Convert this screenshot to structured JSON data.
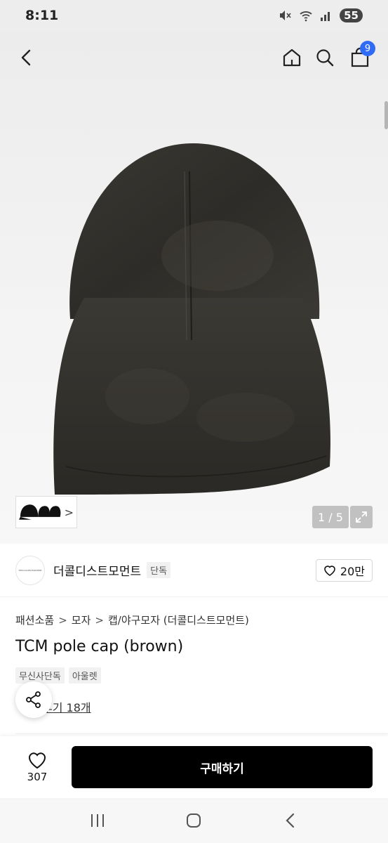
{
  "status_bar": {
    "time": "8:11",
    "battery": "55",
    "icons": [
      "mute-icon",
      "wifi-icon",
      "signal-icon"
    ]
  },
  "header": {
    "back_icon": "chevron-left-icon",
    "home_icon": "home-icon",
    "search_icon": "search-icon",
    "cart_icon": "shopping-bag-icon",
    "cart_count": "9"
  },
  "gallery": {
    "page_counter": "1 / 5",
    "thumb_arrow": ">",
    "expand_icon": "expand-icon"
  },
  "brand": {
    "logo_text": "THECOLDESTMOMENT",
    "name": "더콜디스트모먼트",
    "exclusive_tag": "단독",
    "likes": "20만"
  },
  "product": {
    "breadcrumb": [
      "패션소품",
      "모자",
      "캡/야구모자 (더콜디스트모먼트)"
    ],
    "breadcrumb_sep": ">",
    "title": "TCM pole cap (brown)",
    "tags": [
      "무신사단독",
      "아울렛"
    ],
    "reviews_link": "후기 18개"
  },
  "buy_bar": {
    "wish_count": "307",
    "buy_label": "구매하기"
  },
  "colors": {
    "accent_badge": "#2f6bf5",
    "buy_button": "#000000"
  }
}
